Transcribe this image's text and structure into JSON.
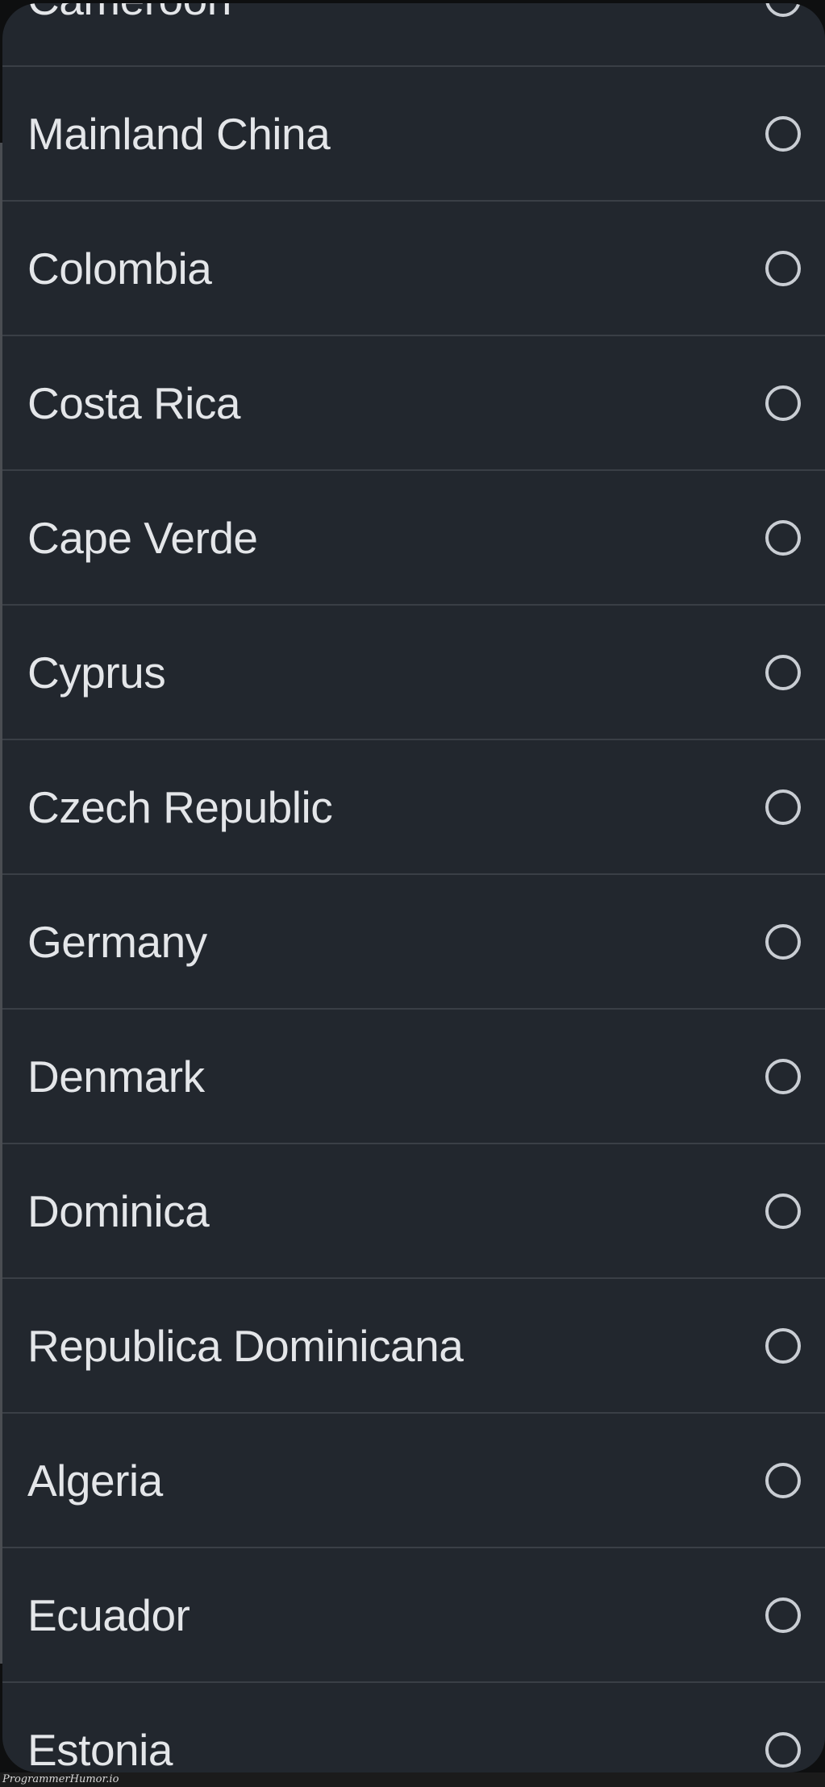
{
  "countries": [
    {
      "label": "Cameroon",
      "selected": false
    },
    {
      "label": "Mainland China",
      "selected": false
    },
    {
      "label": "Colombia",
      "selected": false
    },
    {
      "label": "Costa Rica",
      "selected": false
    },
    {
      "label": "Cape Verde",
      "selected": false
    },
    {
      "label": "Cyprus",
      "selected": false
    },
    {
      "label": "Czech Republic",
      "selected": false
    },
    {
      "label": "Germany",
      "selected": false
    },
    {
      "label": "Denmark",
      "selected": false
    },
    {
      "label": "Dominica",
      "selected": false
    },
    {
      "label": "Republica Dominicana",
      "selected": false
    },
    {
      "label": "Algeria",
      "selected": false
    },
    {
      "label": "Ecuador",
      "selected": false
    },
    {
      "label": "Estonia",
      "selected": false
    }
  ],
  "watermark": "ProgrammerHumor.io",
  "colors": {
    "sheet": "#22272e",
    "divider": "#3a3f46",
    "text": "#e4e6e9",
    "radio": "#c9cdd3"
  }
}
